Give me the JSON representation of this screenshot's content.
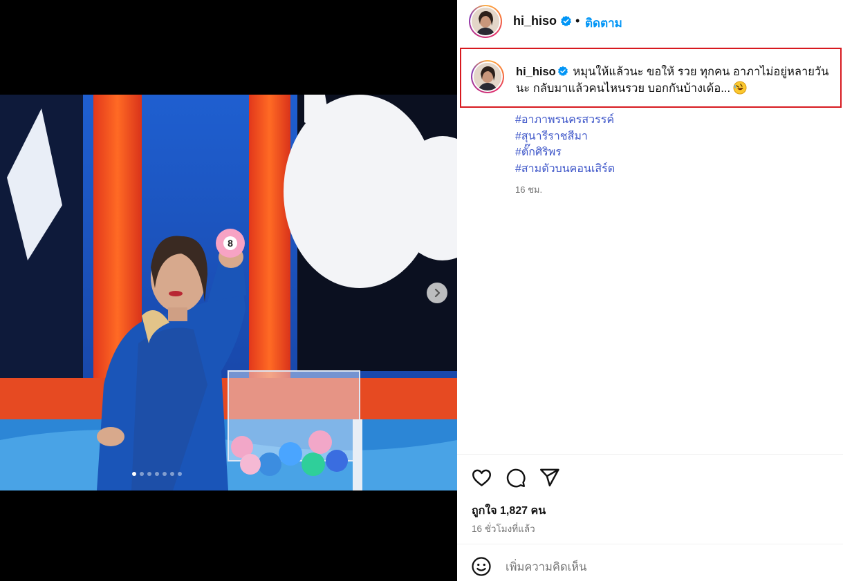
{
  "post": {
    "username": "hi_hiso",
    "separator": "•",
    "follow_label": "ติดตาม",
    "caption_text": "หมุนให้แล้วนะ ขอให้ รวย ทุกคน อาภาไม่อยู่หลายวันนะ กลับมาแล้วคนไหนรวย บอกกันบ้างเด้อ...",
    "caption_emoji": "rolling-on-floor-laughing-emoji",
    "hashtags": [
      "#อาภาพรนครสวรรค์",
      "#สุนารีราชสีมา",
      "#ตั๊กศิริพร",
      "#สามตัวบนคอนเสิร์ต"
    ],
    "caption_time": "16 ชม.",
    "likes": "ถูกใจ 1,827 คน",
    "time_ago": "16 ชั่วโมงที่แล้ว",
    "comment_placeholder": "เพิ่มความคิดเห็น"
  },
  "media": {
    "slide_count": 7,
    "active_slide": 1,
    "ball_number": "8"
  },
  "icons": {
    "like": "heart-icon",
    "comment": "comment-icon",
    "share": "send-icon",
    "next": "chevron-right-icon",
    "emoji": "smiley-icon",
    "verified": "verified-badge-icon"
  },
  "colors": {
    "link": "#0095f6",
    "hashtag": "#3f57c9",
    "highlight_border": "#d7191f",
    "verified": "#0095f6",
    "secondary_text": "#737373"
  }
}
